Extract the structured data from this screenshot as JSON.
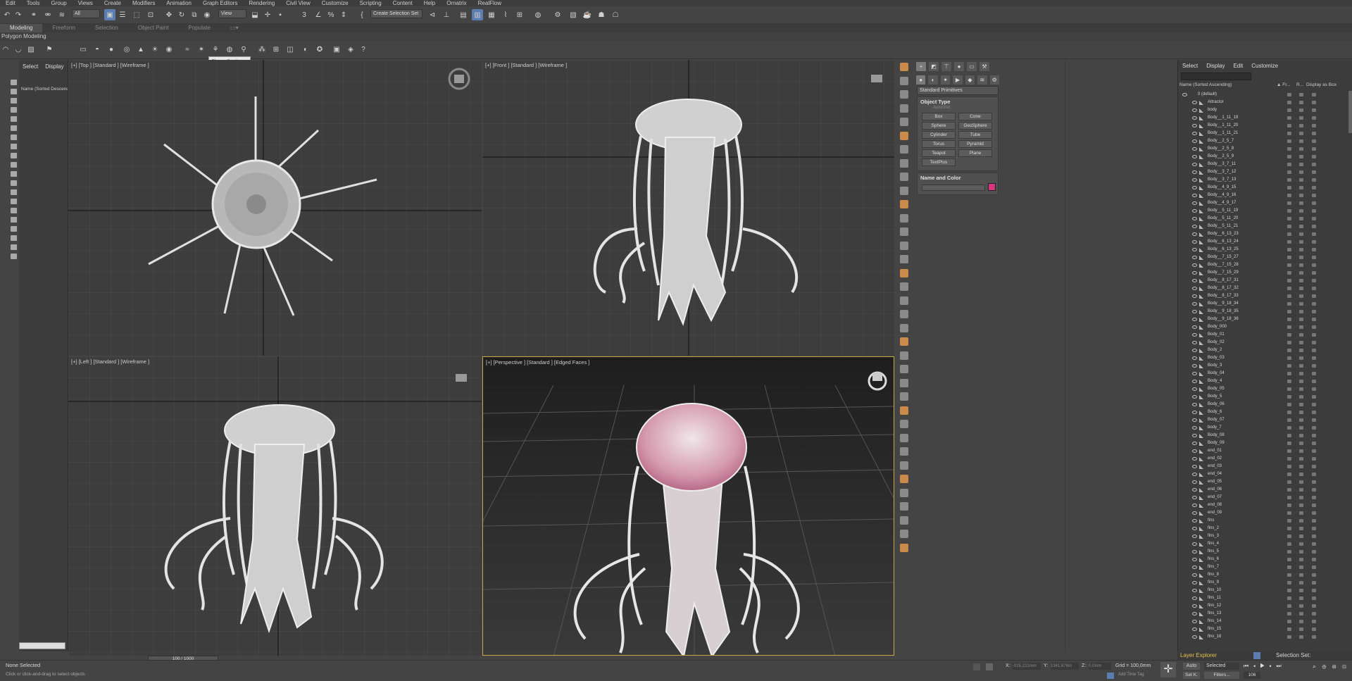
{
  "menu": [
    "Edit",
    "Tools",
    "Group",
    "Views",
    "Create",
    "Modifiers",
    "Animation",
    "Graph Editors",
    "Rendering",
    "Civil View",
    "Customize",
    "Scripting",
    "Content",
    "Help",
    "Ornatrix",
    "RealFlow"
  ],
  "toolbar": {
    "filter_value": "All",
    "view_value": "View",
    "selection_set_placeholder": "Create Selection Set"
  },
  "ribbon": {
    "tabs": [
      "Modeling",
      "Freeform",
      "Selection",
      "Object Paint",
      "Populate"
    ],
    "active_tab": "Modeling",
    "label": "Polygon Modeling",
    "tooltip": "Chaos Scatt..."
  },
  "scene_panel": {
    "tabs": [
      "Select",
      "Display"
    ],
    "header": "Name (Sorted Descending)"
  },
  "viewports": {
    "top": "[+] [Top ] [Standard ] [Wireframe ]",
    "front": "[+] [Front ] [Standard ] [Wireframe ]",
    "left": "[+] [Left ] [Standard ] [Wireframe ]",
    "perspective": "[+] [Perspective ] [Standard ] [Edged Faces ]"
  },
  "command_panel": {
    "category_value": "Standard Primitives",
    "object_type_title": "Object Type",
    "autogrid_label": "AutoGrid",
    "buttons": [
      "Box",
      "Cone",
      "Sphere",
      "GeoSphere",
      "Cylinder",
      "Tube",
      "Torus",
      "Pyramid",
      "Teapot",
      "Plane",
      "TextPlus"
    ],
    "name_color_title": "Name and Color",
    "color": "#d8367c"
  },
  "explorer": {
    "tabs": [
      "Select",
      "Display",
      "Edit",
      "Customize"
    ],
    "col_name": "Name (Sorted Ascending)",
    "col_fr": "▲ Fr...",
    "col_r": "R...",
    "col_display": "Display as Box",
    "rows": [
      "0 (default)",
      "Attractor",
      "body",
      "Body__1_11_19",
      "Body__1_11_20",
      "Body__1_11_21",
      "Body__2_5_7",
      "Body__2_5_8",
      "Body__2_5_9",
      "Body__3_7_11",
      "Body__3_7_12",
      "Body__3_7_13",
      "Body__4_9_15",
      "Body__4_9_16",
      "Body__4_9_17",
      "Body__5_11_19",
      "Body__5_11_20",
      "Body__5_11_21",
      "Body__6_13_23",
      "Body__6_13_24",
      "Body__6_13_25",
      "Body__7_15_27",
      "Body__7_15_28",
      "Body__7_15_29",
      "Body__8_17_31",
      "Body__8_17_32",
      "Body__8_17_33",
      "Body__9_18_34",
      "Body__9_18_35",
      "Body__9_18_36",
      "Body_000",
      "Body_01",
      "Body_02",
      "Body_2",
      "Body_03",
      "Body_3",
      "Body_04",
      "Body_4",
      "Body_05",
      "Body_5",
      "Body_06",
      "Body_6",
      "Body_07",
      "body_7",
      "Body_08",
      "Body_09",
      "end_01",
      "end_02",
      "end_03",
      "end_04",
      "end_05",
      "end_06",
      "end_07",
      "end_08",
      "end_09",
      "fins",
      "fins_2",
      "fins_3",
      "fins_4",
      "fins_5",
      "fins_6",
      "fins_7",
      "fins_8",
      "fins_9",
      "fins_10",
      "fins_11",
      "fins_12",
      "fins_13",
      "fins_14",
      "fins_15",
      "fins_16"
    ],
    "layer_explorer": "Layer Explorer",
    "selection_set": "Selection Set:"
  },
  "status": {
    "selected": "None Selected",
    "hint": "Click or click-and-drag to select objects",
    "time": "100 / 1000",
    "x_label": "X:",
    "x_value": "-915,221mm",
    "y_label": "Y:",
    "y_value": "1341,676m",
    "z_label": "Z:",
    "z_value": "0,0mm",
    "grid": "Grid = 100,0mm",
    "add_time_tag": "Add Time Tag",
    "auto": "Auto",
    "selected_dd": "Selected",
    "set_k": "Set K.",
    "filters": "Filters...",
    "frame": "106"
  }
}
